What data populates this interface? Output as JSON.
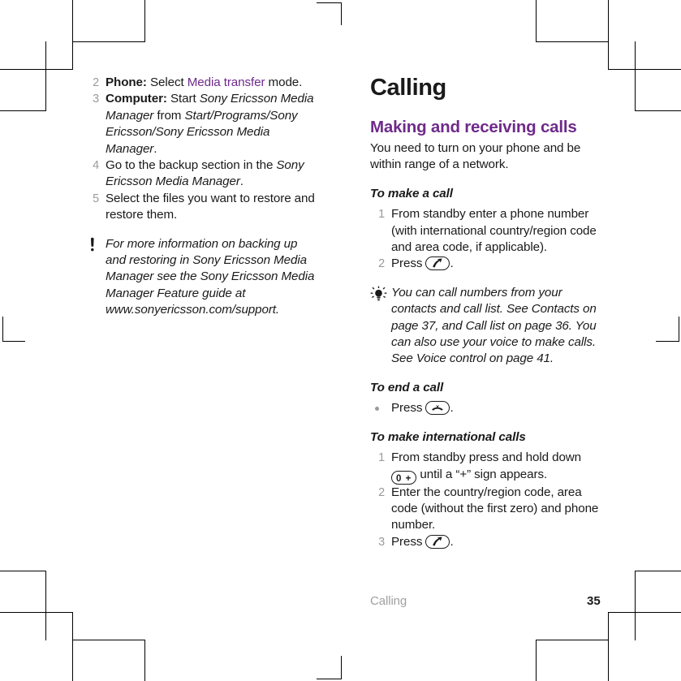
{
  "page": {
    "chapter_title": "Calling",
    "footer_chapter": "Calling",
    "footer_page": "35",
    "accent_color": "#6e2a8a",
    "number_color": "#9a9a9a",
    "text_color": "#1a1a1a"
  },
  "left_column": {
    "steps": [
      {
        "number": "2",
        "parts": [
          {
            "text": "Phone:",
            "style": "bold"
          },
          {
            "text": " Select ",
            "style": "normal"
          },
          {
            "text": "Media transfer",
            "style": "link"
          },
          {
            "text": " mode.",
            "style": "normal"
          }
        ]
      },
      {
        "number": "3",
        "parts": [
          {
            "text": "Computer:",
            "style": "bold"
          },
          {
            "text": " Start ",
            "style": "normal"
          },
          {
            "text": "Sony Ericsson Media Manager",
            "style": "italic"
          },
          {
            "text": " from ",
            "style": "normal"
          },
          {
            "text": "Start/Programs/Sony Ericsson/Sony Ericsson Media Manager",
            "style": "italic"
          },
          {
            "text": ".",
            "style": "normal"
          }
        ]
      },
      {
        "number": "4",
        "parts": [
          {
            "text": "Go to the backup section in the ",
            "style": "normal"
          },
          {
            "text": "Sony Ericsson Media Manager",
            "style": "italic"
          },
          {
            "text": ".",
            "style": "normal"
          }
        ]
      },
      {
        "number": "5",
        "parts": [
          {
            "text": "Select the files you want to restore and restore them.",
            "style": "normal"
          }
        ]
      }
    ],
    "note": {
      "icon": "exclamation-note-icon",
      "text": "For more information on backing up and restoring in Sony Ericsson Media Manager see the Sony Ericsson Media Manager Feature guide at www.sonyericsson.com/support."
    }
  },
  "right_column": {
    "section_title": "Making and receiving calls",
    "intro": "You need to turn on your phone and be within range of a network.",
    "task_make_call": {
      "title": "To make a call",
      "steps": [
        {
          "number": "1",
          "text": "From standby enter a phone number (with international country/region code and area code, if applicable)."
        },
        {
          "number": "2",
          "prefix": "Press ",
          "key": "call-key-icon",
          "suffix": "."
        }
      ]
    },
    "tip": {
      "icon": "lightbulb-tip-icon",
      "text": "You can call numbers from your contacts and call list. See Contacts on page 37, and Call list on page 36. You can also use your voice to make calls. See Voice control on page 41."
    },
    "task_end_call": {
      "title": "To end a call",
      "steps": [
        {
          "bullet": "•",
          "prefix": "Press ",
          "key": "end-call-key-icon",
          "suffix": "."
        }
      ]
    },
    "task_international": {
      "title": "To make international calls",
      "steps": [
        {
          "number": "1",
          "prefix": "From standby press and hold down ",
          "key": "zero-plus-key-icon",
          "key_label": "0 +",
          "suffix": " until a “+” sign appears."
        },
        {
          "number": "2",
          "text": "Enter the country/region code, area code (without the first zero) and phone number."
        },
        {
          "number": "3",
          "prefix": "Press ",
          "key": "call-key-icon",
          "suffix": "."
        }
      ]
    }
  }
}
